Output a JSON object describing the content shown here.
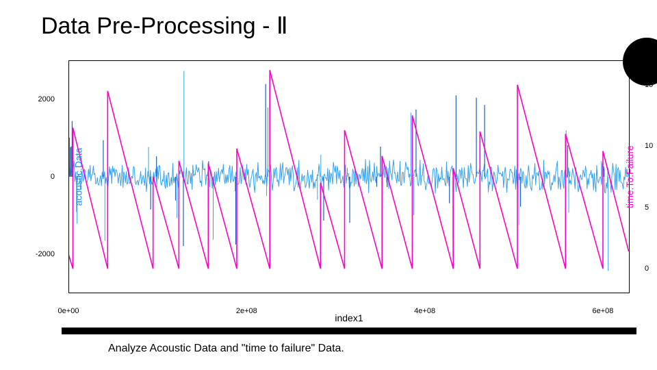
{
  "title": "Data Pre-Processing - Ⅱ",
  "caption": "Analyze Acoustic Data and \"time to failure\" Data.",
  "chart_data": {
    "type": "line",
    "xlabel": "index1",
    "xlim": [
      0,
      630000000
    ],
    "xticks": [
      {
        "value": 0,
        "label": "0e+00"
      },
      {
        "value": 200000000,
        "label": "2e+08"
      },
      {
        "value": 400000000,
        "label": "4e+08"
      },
      {
        "value": 600000000,
        "label": "6e+08"
      }
    ],
    "y_left": {
      "label": "acoustic.Data",
      "lim": [
        -3000,
        3000
      ],
      "ticks": [
        -2000,
        0,
        2000
      ],
      "color": "#1e90ff"
    },
    "y_right": {
      "label": "time.To.Failure",
      "lim": [
        -2,
        17
      ],
      "ticks": [
        0,
        5,
        10,
        15
      ],
      "color": "#ff00c8"
    },
    "series": [
      {
        "name": "acoustic.Data",
        "axis": "left",
        "description": "dense noisy acoustic signal centered near 0 with occasional large spikes",
        "noise_amp": 300,
        "spike_amp_range": [
          -2800,
          2800
        ],
        "color": "#33a2f2"
      },
      {
        "name": "time.To.Failure",
        "axis": "right",
        "color": "#ff00c8",
        "segments": [
          {
            "x_start": 0,
            "y_start": 1.2,
            "x_end": 5000000,
            "y_end": 0
          },
          {
            "x_start": 5000000,
            "y_start": 11.5,
            "x_end": 44000000,
            "y_end": 0
          },
          {
            "x_start": 44000000,
            "y_start": 14.5,
            "x_end": 95000000,
            "y_end": 0
          },
          {
            "x_start": 95000000,
            "y_start": 7.5,
            "x_end": 124000000,
            "y_end": 0
          },
          {
            "x_start": 124000000,
            "y_start": 8.8,
            "x_end": 157000000,
            "y_end": 0
          },
          {
            "x_start": 157000000,
            "y_start": 8.6,
            "x_end": 189000000,
            "y_end": 0
          },
          {
            "x_start": 189000000,
            "y_start": 9.8,
            "x_end": 226000000,
            "y_end": 0
          },
          {
            "x_start": 226000000,
            "y_start": 16.2,
            "x_end": 283000000,
            "y_end": 0
          },
          {
            "x_start": 283000000,
            "y_start": 7.0,
            "x_end": 310000000,
            "y_end": 0
          },
          {
            "x_start": 310000000,
            "y_start": 11.3,
            "x_end": 352000000,
            "y_end": 0
          },
          {
            "x_start": 352000000,
            "y_start": 9.2,
            "x_end": 386000000,
            "y_end": 0
          },
          {
            "x_start": 386000000,
            "y_start": 12.5,
            "x_end": 432000000,
            "y_end": 0
          },
          {
            "x_start": 432000000,
            "y_start": 8.2,
            "x_end": 462000000,
            "y_end": 0
          },
          {
            "x_start": 462000000,
            "y_start": 11.2,
            "x_end": 504000000,
            "y_end": 0
          },
          {
            "x_start": 504000000,
            "y_start": 15.0,
            "x_end": 558000000,
            "y_end": 0
          },
          {
            "x_start": 558000000,
            "y_start": 11.0,
            "x_end": 600000000,
            "y_end": 0
          },
          {
            "x_start": 600000000,
            "y_start": 9.6,
            "x_end": 629000000,
            "y_end": 1.4
          }
        ]
      }
    ]
  }
}
